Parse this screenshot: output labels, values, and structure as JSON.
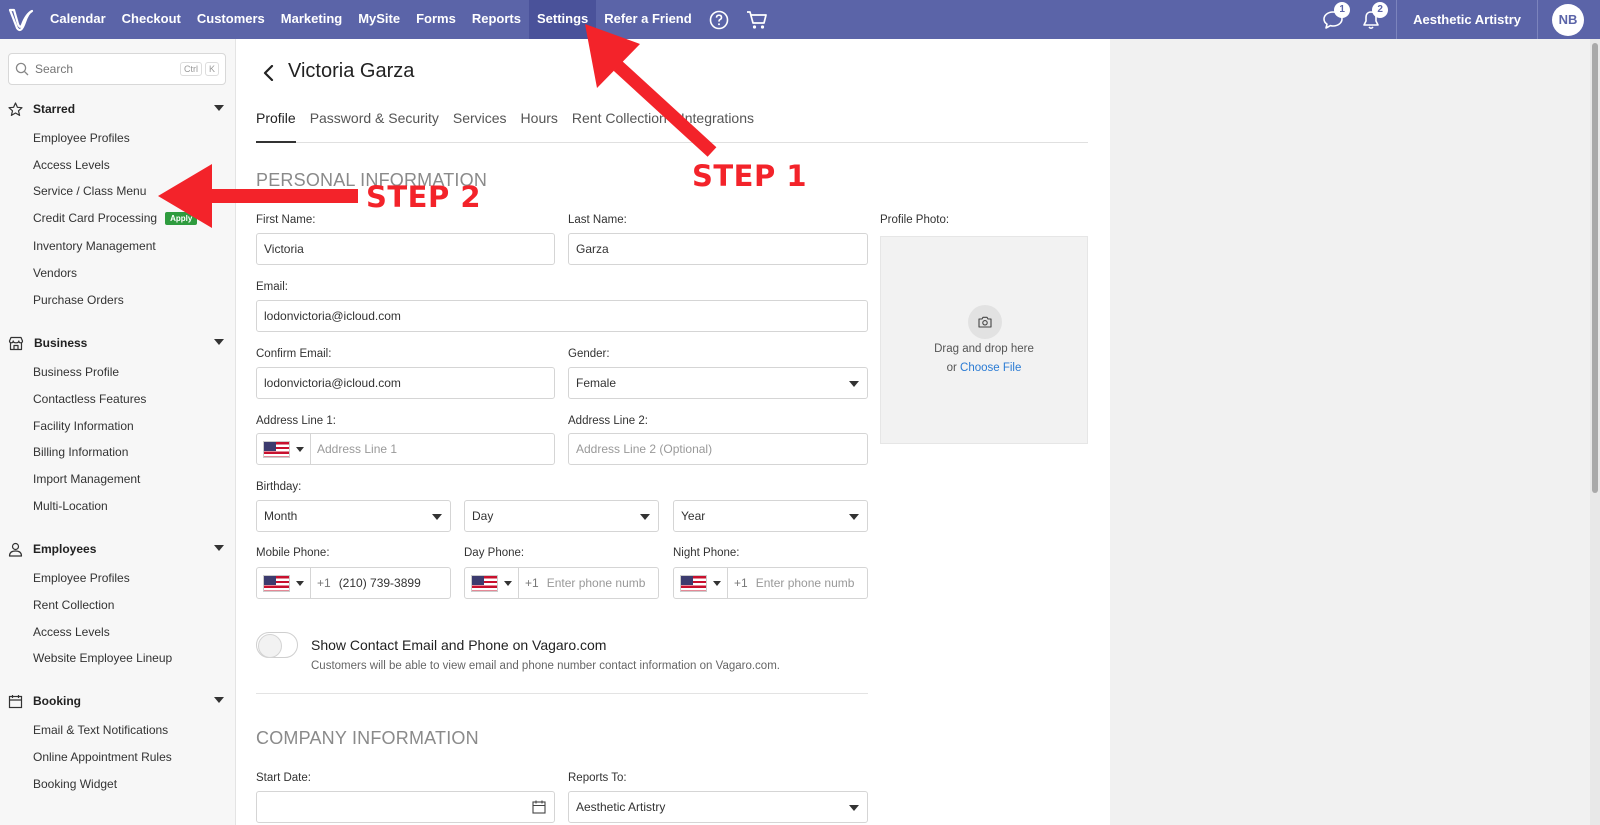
{
  "topnav": {
    "items": [
      "Calendar",
      "Checkout",
      "Customers",
      "Marketing",
      "MySite",
      "Forms",
      "Reports",
      "Settings",
      "Refer a Friend"
    ],
    "active": "Settings",
    "messages_count": "1",
    "notifications_count": "2",
    "business_name": "Aesthetic Artistry",
    "avatar_initials": "NB"
  },
  "sidebar": {
    "search_placeholder": "Search",
    "shortcut_ctrl": "Ctrl",
    "shortcut_key": "K",
    "sections": [
      {
        "title": "Starred",
        "items": [
          "Employee Profiles",
          "Access Levels",
          "Service / Class Menu",
          "Credit Card Processing",
          "Inventory Management",
          "Vendors",
          "Purchase Orders"
        ]
      },
      {
        "title": "Business",
        "items": [
          "Business Profile",
          "Contactless Features",
          "Facility Information",
          "Billing Information",
          "Import Management",
          "Multi-Location"
        ]
      },
      {
        "title": "Employees",
        "items": [
          "Employee Profiles",
          "Rent Collection",
          "Access Levels",
          "Website Employee Lineup"
        ]
      },
      {
        "title": "Booking",
        "items": [
          "Email & Text Notifications",
          "Online Appointment Rules",
          "Booking Widget"
        ]
      }
    ],
    "apply_badge": "Apply"
  },
  "page": {
    "title": "Victoria Garza",
    "tabs": [
      "Profile",
      "Password & Security",
      "Services",
      "Hours",
      "Rent Collection",
      "Integrations"
    ],
    "active_tab": "Profile"
  },
  "personal": {
    "section_title": "PERSONAL INFORMATION",
    "first_name_label": "First Name:",
    "first_name": "Victoria",
    "last_name_label": "Last Name:",
    "last_name": "Garza",
    "email_label": "Email:",
    "email": "lodonvictoria@icloud.com",
    "confirm_email_label": "Confirm Email:",
    "confirm_email": "lodonvictoria@icloud.com",
    "gender_label": "Gender:",
    "gender": "Female",
    "address1_label": "Address Line 1:",
    "address1_placeholder": "Address Line 1",
    "address2_label": "Address Line 2:",
    "address2_placeholder": "Address Line 2 (Optional)",
    "birthday_label": "Birthday:",
    "month": "Month",
    "day": "Day",
    "year": "Year",
    "mobile_label": "Mobile Phone:",
    "mobile_code": "+1",
    "mobile": "(210) 739-3899",
    "day_phone_label": "Day Phone:",
    "day_phone_code": "+1",
    "day_phone_placeholder": "Enter phone numb",
    "night_phone_label": "Night Phone:",
    "night_phone_code": "+1",
    "night_phone_placeholder": "Enter phone numb",
    "profile_photo_label": "Profile Photo:",
    "drag_text": "Drag and drop here",
    "or_text": "or ",
    "choose_file": "Choose File",
    "toggle_title": "Show Contact Email and Phone on Vagaro.com",
    "toggle_desc": "Customers will be able to view email and phone number contact information on Vagaro.com."
  },
  "company": {
    "section_title": "COMPANY INFORMATION",
    "start_date_label": "Start Date:",
    "reports_to_label": "Reports To:",
    "reports_to": "Aesthetic Artistry"
  },
  "annotations": {
    "step1": "STEP 1",
    "step2": "STEP 2",
    "color": "#f3232a"
  }
}
